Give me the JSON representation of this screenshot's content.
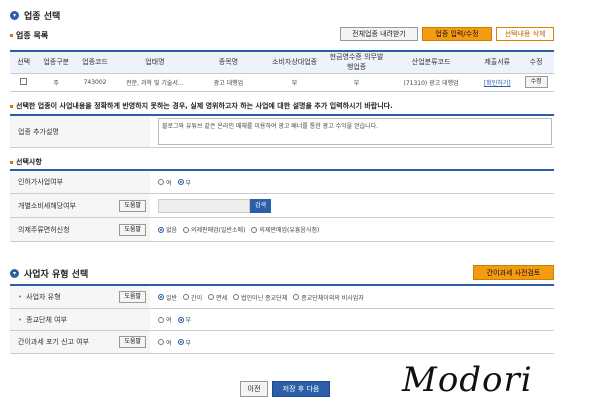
{
  "sec1": {
    "title": "업종 선택",
    "icon": "down-arrow-circle-icon"
  },
  "buttons": {
    "full_list": "전체업종 내려받기",
    "input_edit": "업종 입력/수정",
    "delete_sel": "선택내용 삭제"
  },
  "industry_list": {
    "label": "업종 목록"
  },
  "table": {
    "headers": [
      "선택",
      "업종구분",
      "업종코드",
      "업태명",
      "종목명",
      "소비자상대업종",
      "현금영수증 의무발행업종",
      "산업분류코드",
      "제출서류",
      "수정"
    ],
    "row": {
      "type": "주",
      "code": "743002",
      "biz": "전문, 과학 및 기술서...",
      "item": "광고 대행업",
      "consumer": "부",
      "cash": "부",
      "class": "(71310) 광고 대행업",
      "docs": "[확인하기]",
      "edit": "수정"
    }
  },
  "notice": "선택한 업종이 사업내용을 정확하게 반영하지 못하는 경우, 실제 영위하고자 하는 사업에 대한 설명을 추가 입력하시기 바랍니다.",
  "desc": {
    "label": "업종 추가설명",
    "value": "블로그와 유튜브 같은 온라인 매체를 이용하여 광고 배너를 통한 광고 수익을 얻습니다."
  },
  "selection": {
    "label": "선택사항",
    "licensed": {
      "label": "인허가사업여부",
      "opt1": "여",
      "opt2": "부"
    },
    "excise": {
      "label": "개별소비세해당여부",
      "help": "도움말",
      "search": "검색"
    },
    "liquor": {
      "label": "의제주류면허신청",
      "help": "도움말",
      "opt1": "없음",
      "opt2": "의제판매업(일반소매)",
      "opt3": "의제판매업(유흥음식점)"
    }
  },
  "sec2": {
    "title": "사업자 유형 선택",
    "icon": "down-arrow-circle-icon",
    "simple_check": "간이과세 사전검토"
  },
  "biztype": {
    "label": "사업자 유형",
    "help": "도움말",
    "opts": [
      "일반",
      "간이",
      "면세",
      "법인아닌 종교단체",
      "종교단체이외의 비사업자"
    ]
  },
  "religious": {
    "label": "종교단체 여부",
    "opt1": "여",
    "opt2": "부"
  },
  "simple_giveup": {
    "label": "간이과세 포기 신고 여부",
    "help": "도움말",
    "opt1": "여",
    "opt2": "부"
  },
  "nav": {
    "prev": "이전",
    "next": "저장 후 다음"
  },
  "watermark": "Modori"
}
